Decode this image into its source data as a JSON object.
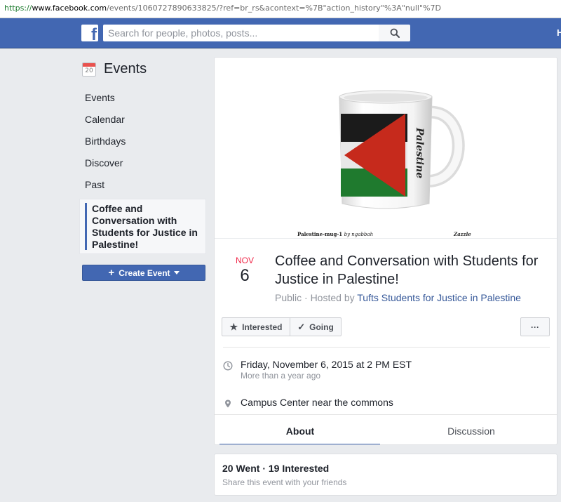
{
  "browser": {
    "url_scheme": "https://",
    "url_host": "www.facebook.com",
    "url_rest": "/events/1060727890633825/?ref=br_rs&acontext=%7B\"action_history\"%3A\"null\"%7D"
  },
  "header": {
    "logo": "f",
    "search_placeholder": "Search for people, photos, posts...",
    "home_label": "H"
  },
  "sidebar": {
    "title": "Events",
    "calendar_icon_day": "20",
    "items": [
      {
        "label": "Events"
      },
      {
        "label": "Calendar"
      },
      {
        "label": "Birthdays"
      },
      {
        "label": "Discover"
      },
      {
        "label": "Past"
      }
    ],
    "active_item": "Coffee and Conversation with Students for Justice in Palestine!",
    "create_button": "Create Event"
  },
  "event": {
    "cover": {
      "mug_text": "Palestine",
      "caption_title": "Palestine-mug-1",
      "caption_by": "by ngabbah",
      "caption_brand": "Zazzle",
      "flag_colors": {
        "black": "#1b1b1b",
        "white": "#e8e8e8",
        "green": "#1f7a2e",
        "red": "#c62a1c"
      }
    },
    "month": "NOV",
    "day": "6",
    "title": "Coffee and Conversation with Students for Justice in Palestine!",
    "privacy": "Public · Hosted by",
    "host": "Tufts Students for Justice in Palestine",
    "buttons": {
      "interested": "Interested",
      "going": "Going",
      "more": "···"
    },
    "datetime": "Friday, November 6, 2015 at 2 PM EST",
    "datetime_relative": "More than a year ago",
    "location": "Campus Center near the commons",
    "tabs": [
      {
        "label": "About",
        "active": true
      },
      {
        "label": "Discussion",
        "active": false
      }
    ]
  },
  "stats": {
    "summary": "20 Went · 19 Interested",
    "share_text": "Share this event with your friends"
  },
  "colors": {
    "brand_blue": "#4267b2",
    "background": "#e9ebee",
    "link": "#365899",
    "date_red": "#f02849"
  }
}
